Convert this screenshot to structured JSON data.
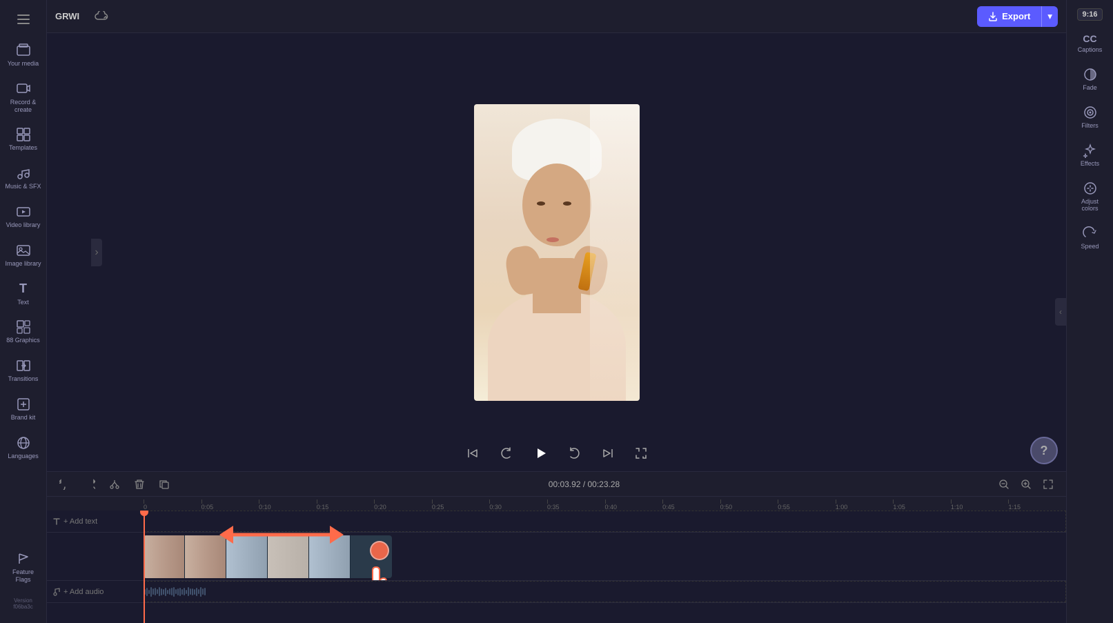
{
  "app": {
    "title": "GRWI"
  },
  "topbar": {
    "title": "GRWI",
    "export_label": "Export",
    "export_dropdown_label": "▾"
  },
  "sidebar_left": {
    "items": [
      {
        "id": "your-media",
        "label": "Your media",
        "icon": "📁"
      },
      {
        "id": "record",
        "label": "Record & create",
        "icon": "🎬"
      },
      {
        "id": "templates",
        "label": "Templates",
        "icon": "⊞"
      },
      {
        "id": "music",
        "label": "Music & SFX",
        "icon": "♪"
      },
      {
        "id": "video-library",
        "label": "Video library",
        "icon": "▶"
      },
      {
        "id": "image-library",
        "label": "Image library",
        "icon": "🖼"
      },
      {
        "id": "text",
        "label": "Text",
        "icon": "T"
      },
      {
        "id": "graphics",
        "label": "88 Graphics",
        "icon": "✦"
      },
      {
        "id": "transitions",
        "label": "Transitions",
        "icon": "⇄"
      },
      {
        "id": "brand-kit",
        "label": "Brand kit",
        "icon": "◈"
      },
      {
        "id": "languages",
        "label": "Languages",
        "icon": "🌐"
      },
      {
        "id": "feature-flags",
        "label": "Feature Flags",
        "icon": "⚑"
      },
      {
        "id": "version",
        "label": "Version f06ba3c",
        "icon": ""
      }
    ]
  },
  "sidebar_right": {
    "aspect_ratio": "9:16",
    "items": [
      {
        "id": "captions",
        "label": "Captions",
        "icon": "CC"
      },
      {
        "id": "fade",
        "label": "Fade",
        "icon": "◑"
      },
      {
        "id": "filters",
        "label": "Filters",
        "icon": "⊙"
      },
      {
        "id": "effects",
        "label": "Effects",
        "icon": "✦"
      },
      {
        "id": "adjust-colors",
        "label": "Adjust colors",
        "icon": "⚙"
      },
      {
        "id": "speed",
        "label": "Speed",
        "icon": "↻"
      }
    ]
  },
  "timeline": {
    "current_time": "00:03.92",
    "total_time": "00:23.28",
    "time_display": "00:03.92 / 00:23.28",
    "ruler_marks": [
      "0:05",
      "0:10",
      "0:15",
      "0:20",
      "0:25",
      "0:30",
      "0:35",
      "0:40",
      "0:45",
      "0:50",
      "0:55",
      "1:00",
      "1:05",
      "1:10",
      "1:15"
    ],
    "tracks": [
      {
        "id": "text-track",
        "label": "+ Add text",
        "type": "text"
      },
      {
        "id": "video-track",
        "label": "",
        "type": "video"
      },
      {
        "id": "audio-track",
        "label": "+ Add audio",
        "type": "audio"
      }
    ]
  },
  "toolbar": {
    "undo_label": "↺",
    "redo_label": "↻",
    "cut_label": "✂",
    "delete_label": "🗑",
    "copy_label": "⎘",
    "zoom_in_label": "+",
    "zoom_out_label": "−",
    "expand_label": "⤢"
  },
  "playback": {
    "skip_back_label": "⏮",
    "rewind_label": "↺",
    "play_label": "▶",
    "forward_label": "↻",
    "skip_forward_label": "⏭",
    "fullscreen_label": "⛶"
  }
}
